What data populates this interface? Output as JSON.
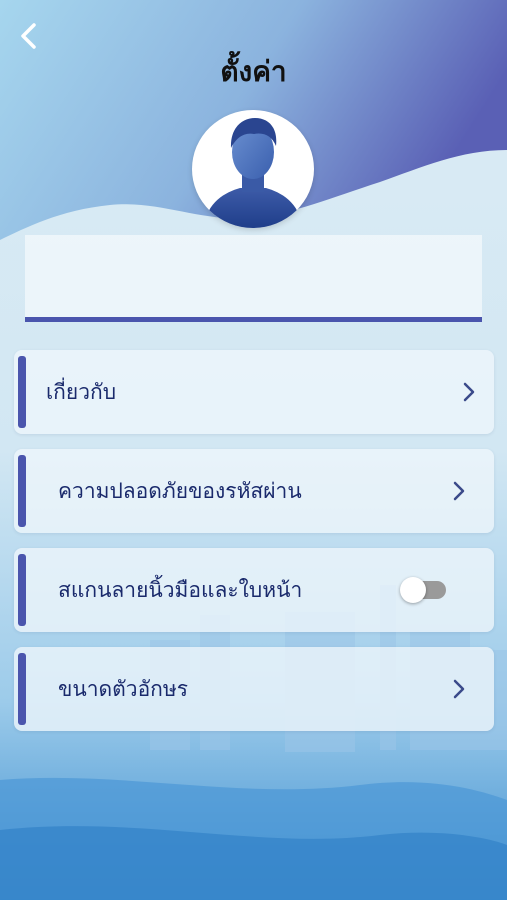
{
  "header": {
    "title": "ตั้งค่า",
    "back_icon": "chevron-left-icon"
  },
  "profile": {
    "avatar_icon": "user-silhouette-icon",
    "name": ""
  },
  "menu": [
    {
      "label": "เกี่ยวกับ",
      "control": "chevron-right-icon"
    },
    {
      "label": "ความปลอดภัยของรหัสผ่าน",
      "control": "chevron-right-icon"
    },
    {
      "label": "สแกนลายนิ้วมือและใบหน้า",
      "control": "toggle",
      "toggle_on": false
    },
    {
      "label": "ขนาดตัวอักษร",
      "control": "chevron-right-icon"
    }
  ],
  "colors": {
    "accent": "#4a55ad",
    "header_gradient_start": "#9fd1ea",
    "header_gradient_end": "#5a60b5"
  }
}
